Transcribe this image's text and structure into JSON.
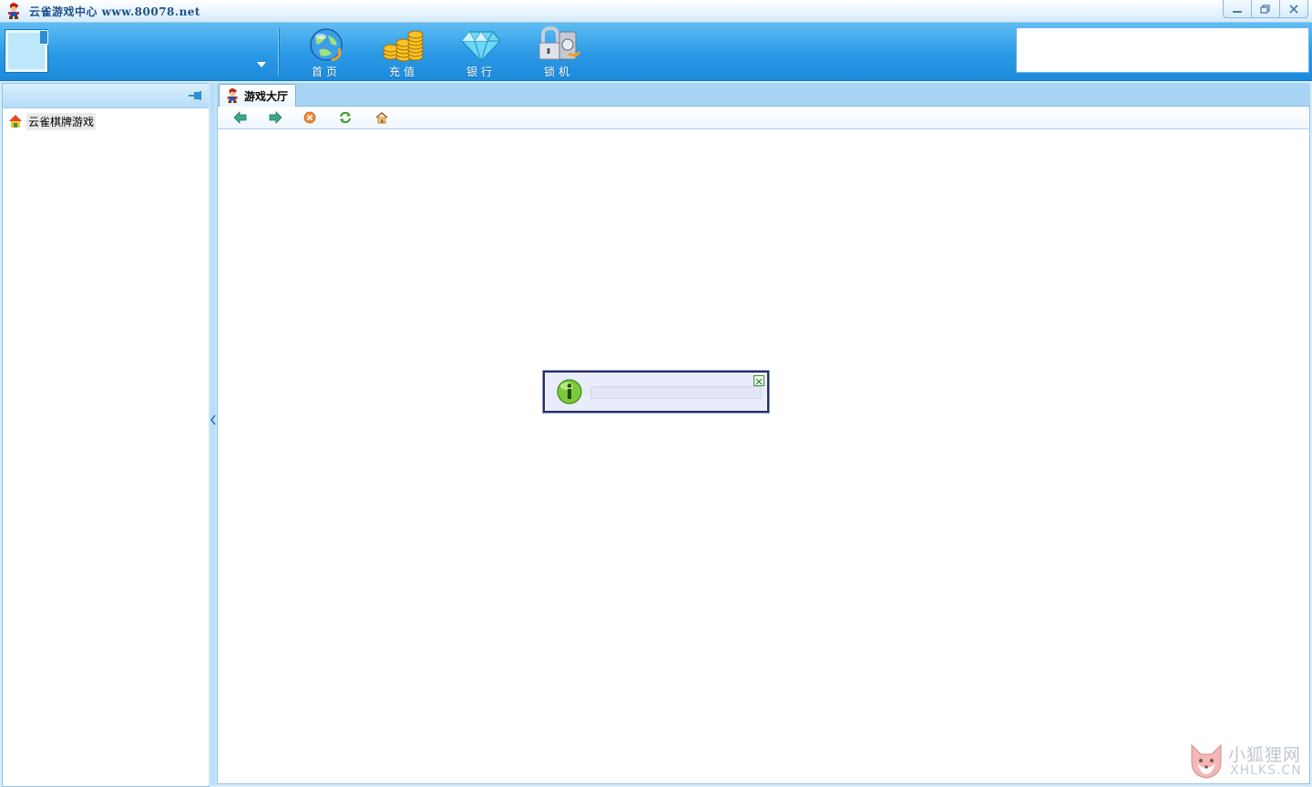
{
  "titlebar": {
    "title": "云雀游戏中心  www.80078.net",
    "logo_icon": "mario-logo-icon",
    "buttons": [
      "minimize-icon",
      "restore-icon",
      "close-icon"
    ]
  },
  "toolbar": {
    "buttons": [
      {
        "label": "首页",
        "icon": "globe-icon"
      },
      {
        "label": "充值",
        "icon": "coins-icon"
      },
      {
        "label": "银行",
        "icon": "diamond-icon"
      },
      {
        "label": "锁机",
        "icon": "lock-icon"
      }
    ]
  },
  "sidebar": {
    "items": [
      {
        "label": "云雀棋牌游戏",
        "icon": "house-icon"
      }
    ]
  },
  "main": {
    "tabs": [
      {
        "label": "游戏大厅",
        "icon": "mario-logo-icon"
      }
    ],
    "nav": [
      "back-arrow-icon",
      "forward-arrow-icon",
      "stop-icon",
      "refresh-icon",
      "home-icon"
    ]
  },
  "watermark": {
    "cn": "小狐狸网",
    "en": "XHLKS.CN"
  },
  "colors": {
    "toolbar_blue": "#2a99e6",
    "panel_border": "#8fc3e8",
    "tab_strip": "#a9d5f5"
  }
}
